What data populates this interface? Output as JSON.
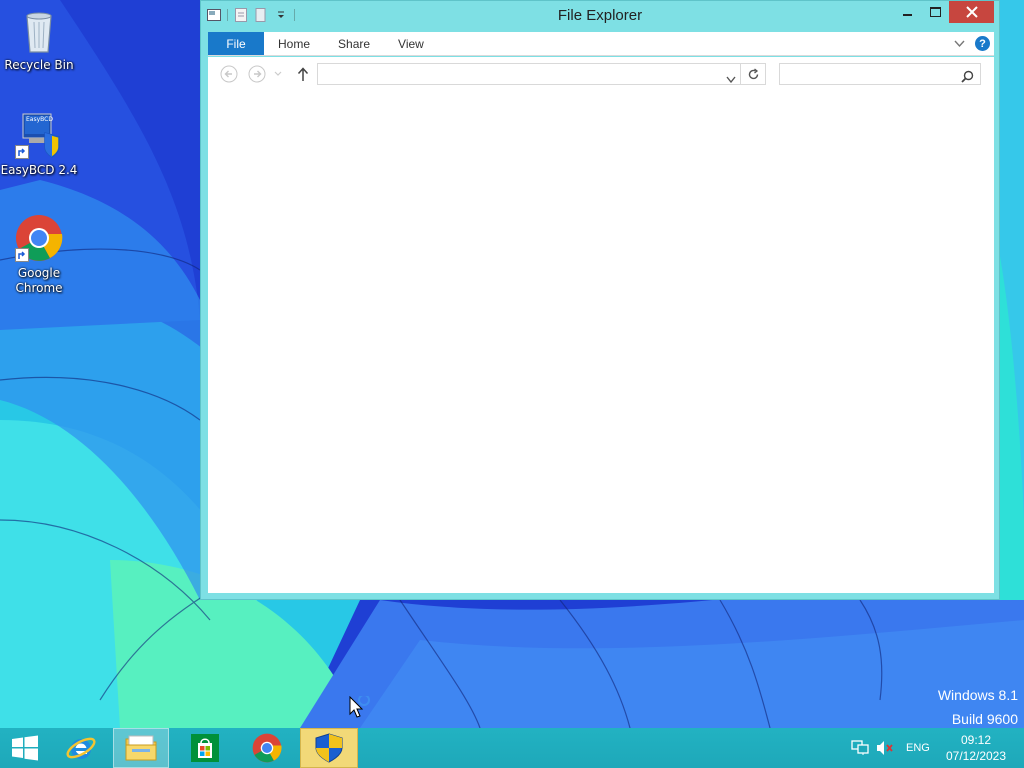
{
  "desktop": {
    "icons": [
      {
        "label": "Recycle Bin",
        "icon": "recycle-bin-icon"
      },
      {
        "label": "EasyBCD 2.4",
        "icon": "easybcd-icon",
        "badge_text": "EasyBCD"
      },
      {
        "label": "Google Chrome",
        "icon": "chrome-icon"
      }
    ]
  },
  "window": {
    "title": "File Explorer",
    "ribbon_tabs": [
      "File",
      "Home",
      "Share",
      "View"
    ],
    "help_label": "?",
    "address_value": "",
    "search_value": ""
  },
  "watermark": {
    "line1": "Windows 8.1",
    "line2": "Build 9600"
  },
  "taskbar": {
    "items": [
      "start-icon",
      "internet-explorer-icon",
      "file-explorer-icon",
      "store-icon",
      "chrome-icon",
      "security-shield-icon"
    ],
    "tray": {
      "language": "ENG",
      "time": "09:12",
      "date": "07/12/2023"
    }
  },
  "colors": {
    "window_frame": "#7ee0e4",
    "ribbon_file_tab": "#1979ca",
    "close_button": "#c7463f",
    "taskbar": "#22b2c2",
    "taskbar_highlight": "#f2d978"
  }
}
